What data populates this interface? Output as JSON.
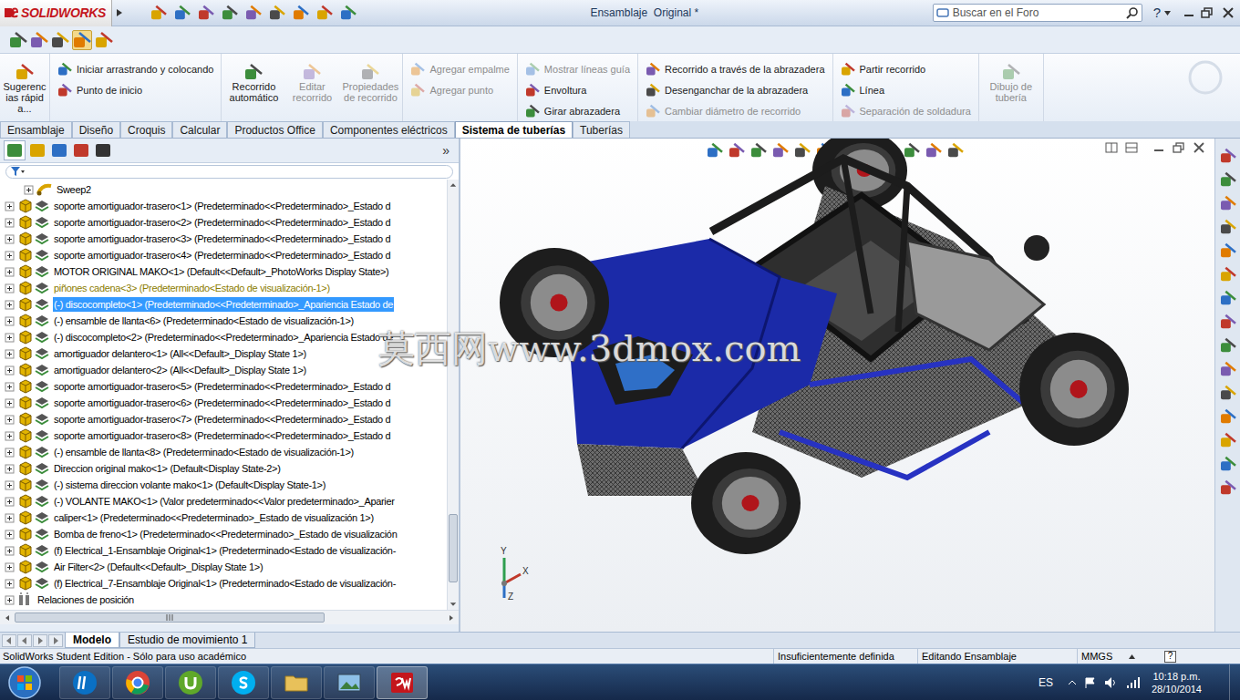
{
  "window": {
    "app": "SOLIDWORKS",
    "title": "Ensamblaje  Original *"
  },
  "search": {
    "placeholder": "Buscar en el Foro"
  },
  "help": "?",
  "command_groups": [
    {
      "kind": "large",
      "buttons": [
        {
          "label": "Sugerencias rápida...",
          "disabled": false
        }
      ]
    },
    {
      "kind": "small",
      "buttons": [
        {
          "label": "Iniciar arrastrando y colocando",
          "disabled": false
        },
        {
          "label": "Punto de inicio",
          "disabled": false
        }
      ]
    },
    {
      "kind": "large",
      "buttons": [
        {
          "label": "Recorrido automático",
          "disabled": false
        },
        {
          "label": "Editar recorrido",
          "disabled": true
        },
        {
          "label": "Propiedades de recorrido",
          "disabled": true
        }
      ]
    },
    {
      "kind": "small",
      "buttons": [
        {
          "label": "Agregar empalme",
          "disabled": true
        },
        {
          "label": "Agregar punto",
          "disabled": true
        }
      ]
    },
    {
      "kind": "small",
      "buttons": [
        {
          "label": "Mostrar líneas guía",
          "disabled": true
        },
        {
          "label": "Envoltura",
          "disabled": false
        },
        {
          "label": "Girar abrazadera",
          "disabled": false
        }
      ]
    },
    {
      "kind": "small",
      "buttons": [
        {
          "label": "Recorrido a través de la abrazadera",
          "disabled": false
        },
        {
          "label": "Desenganchar de la abrazadera",
          "disabled": false
        },
        {
          "label": "Cambiar diámetro de recorrido",
          "disabled": true
        }
      ]
    },
    {
      "kind": "small",
      "buttons": [
        {
          "label": "Partir recorrido",
          "disabled": false
        },
        {
          "label": "Línea",
          "disabled": false
        },
        {
          "label": "Separación de soldadura",
          "disabled": true
        }
      ]
    },
    {
      "kind": "large",
      "buttons": [
        {
          "label": "Dibujo de tubería",
          "disabled": true
        }
      ]
    }
  ],
  "tabs": [
    {
      "label": "Ensamblaje",
      "selected": false
    },
    {
      "label": "Diseño",
      "selected": false
    },
    {
      "label": "Croquis",
      "selected": false
    },
    {
      "label": "Calcular",
      "selected": false
    },
    {
      "label": "Productos Office",
      "selected": false
    },
    {
      "label": "Componentes eléctricos",
      "selected": false
    },
    {
      "label": "Sistema de tuberías",
      "selected": true
    },
    {
      "label": "Tuberías",
      "selected": false
    }
  ],
  "panel": {
    "more": "»"
  },
  "tree": [
    {
      "label": "Sweep2",
      "kind": "feature",
      "selected": false,
      "color": "#000000"
    },
    {
      "label": "soporte amortiguador-trasero<1> (Predeterminado<<Predeterminado>_Estado d",
      "kind": "component",
      "selected": false,
      "color": "#000000"
    },
    {
      "label": "soporte amortiguador-trasero<2> (Predeterminado<<Predeterminado>_Estado d",
      "kind": "component",
      "selected": false,
      "color": "#000000"
    },
    {
      "label": "soporte amortiguador-trasero<3> (Predeterminado<<Predeterminado>_Estado d",
      "kind": "component",
      "selected": false,
      "color": "#000000"
    },
    {
      "label": "soporte amortiguador-trasero<4> (Predeterminado<<Predeterminado>_Estado d",
      "kind": "component",
      "selected": false,
      "color": "#000000"
    },
    {
      "label": "MOTOR ORIGINAL MAKO<1> (Default<<Default>_PhotoWorks Display State>)",
      "kind": "component",
      "selected": false,
      "color": "#000000"
    },
    {
      "label": "piñones cadena<3> (Predeterminado<Estado de visualización-1>)",
      "kind": "component",
      "selected": false,
      "color": "#8c7d00"
    },
    {
      "label": "(-) discocompleto<1> (Predeterminado<<Predeterminado>_Apariencia Estado de",
      "kind": "component",
      "selected": true,
      "color": "#000000"
    },
    {
      "label": "(-) ensamble de llanta<6> (Predeterminado<Estado de visualización-1>)",
      "kind": "component",
      "selected": false,
      "color": "#000000"
    },
    {
      "label": "(-) discocompleto<2> (Predeterminado<<Predeterminado>_Apariencia Estado de",
      "kind": "component",
      "selected": false,
      "color": "#000000"
    },
    {
      "label": "amortiguador delantero<1> (All<<Default>_Display State 1>)",
      "kind": "component",
      "selected": false,
      "color": "#000000"
    },
    {
      "label": "amortiguador delantero<2> (All<<Default>_Display State 1>)",
      "kind": "component",
      "selected": false,
      "color": "#000000"
    },
    {
      "label": "soporte amortiguador-trasero<5> (Predeterminado<<Predeterminado>_Estado d",
      "kind": "component",
      "selected": false,
      "color": "#000000"
    },
    {
      "label": "soporte amortiguador-trasero<6> (Predeterminado<<Predeterminado>_Estado d",
      "kind": "component",
      "selected": false,
      "color": "#000000"
    },
    {
      "label": "soporte amortiguador-trasero<7> (Predeterminado<<Predeterminado>_Estado d",
      "kind": "component",
      "selected": false,
      "color": "#000000"
    },
    {
      "label": "soporte amortiguador-trasero<8> (Predeterminado<<Predeterminado>_Estado d",
      "kind": "component",
      "selected": false,
      "color": "#000000"
    },
    {
      "label": "(-) ensamble de llanta<8> (Predeterminado<Estado de visualización-1>)",
      "kind": "component",
      "selected": false,
      "color": "#000000"
    },
    {
      "label": "Direccion original mako<1> (Default<Display State-2>)",
      "kind": "component",
      "selected": false,
      "color": "#000000"
    },
    {
      "label": "(-) sistema direccion volante mako<1> (Default<Display State-1>)",
      "kind": "component",
      "selected": false,
      "color": "#000000"
    },
    {
      "label": "(-) VOLANTE MAKO<1> (Valor predeterminado<<Valor predeterminado>_Aparier",
      "kind": "component",
      "selected": false,
      "color": "#000000"
    },
    {
      "label": "caliper<1> (Predeterminado<<Predeterminado>_Estado de visualización 1>)",
      "kind": "component",
      "selected": false,
      "color": "#000000"
    },
    {
      "label": "Bomba de freno<1> (Predeterminado<<Predeterminado>_Estado de visualización",
      "kind": "component",
      "selected": false,
      "color": "#000000"
    },
    {
      "label": "(f) Electrical_1-Ensamblaje  Original<1> (Predeterminado<Estado de visualización-",
      "kind": "component",
      "selected": false,
      "color": "#000000"
    },
    {
      "label": "Air Filter<2> (Default<<Default>_Display State 1>)",
      "kind": "component",
      "selected": false,
      "color": "#000000"
    },
    {
      "label": "(f) Electrical_7-Ensamblaje  Original<1> (Predeterminado<Estado de visualización-",
      "kind": "component",
      "selected": false,
      "color": "#000000"
    },
    {
      "label": "Relaciones de posición",
      "kind": "mates",
      "selected": false,
      "color": "#000000"
    }
  ],
  "viewport": {
    "triad": [
      "Y",
      "X",
      "Z"
    ]
  },
  "bottom_tabs": [
    {
      "label": "Modelo",
      "selected": true
    },
    {
      "label": "Estudio de movimiento 1",
      "selected": false
    }
  ],
  "status_bar": {
    "edition": "SolidWorks Student Edition - Sólo para uso académico",
    "definition": "Insuficientemente definida",
    "mode": "Editando Ensamblaje",
    "units": "MMGS",
    "help": "?"
  },
  "taskbar": {
    "language": "ES",
    "time": "10:18 p.m.",
    "date": "28/10/2014"
  },
  "watermark": "莫西网www.3dmox.com"
}
